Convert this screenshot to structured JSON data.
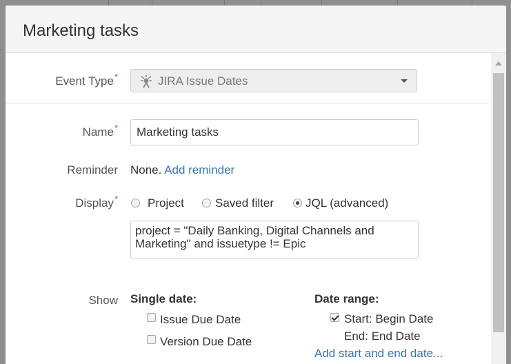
{
  "dialog": {
    "title": "Marketing tasks"
  },
  "form": {
    "event_type": {
      "label": "Event Type",
      "value": "JIRA Issue Dates",
      "icon": "jira-issue-dates-icon"
    },
    "name": {
      "label": "Name",
      "value": "Marketing tasks"
    },
    "reminder": {
      "label": "Reminder",
      "value": "None.",
      "link": "Add reminder"
    },
    "display": {
      "label": "Display",
      "options": [
        "Project",
        "Saved filter",
        "JQL (advanced)"
      ],
      "selected": "JQL (advanced)",
      "jql": "project = \"Daily Banking, Digital Channels and Marketing\" and issuetype != Epic"
    },
    "show": {
      "label": "Show",
      "single_date": {
        "heading": "Single date:",
        "options": [
          {
            "label": "Issue Due Date",
            "checked": false
          },
          {
            "label": "Version Due Date",
            "checked": false
          }
        ]
      },
      "date_range": {
        "heading": "Date range:",
        "start_label": "Start: Begin Date",
        "start_checked": true,
        "end_label": "End: End Date",
        "add_link": "Add start and end date..."
      }
    }
  },
  "colors": {
    "link": "#3b73af",
    "required": "#d04437"
  }
}
